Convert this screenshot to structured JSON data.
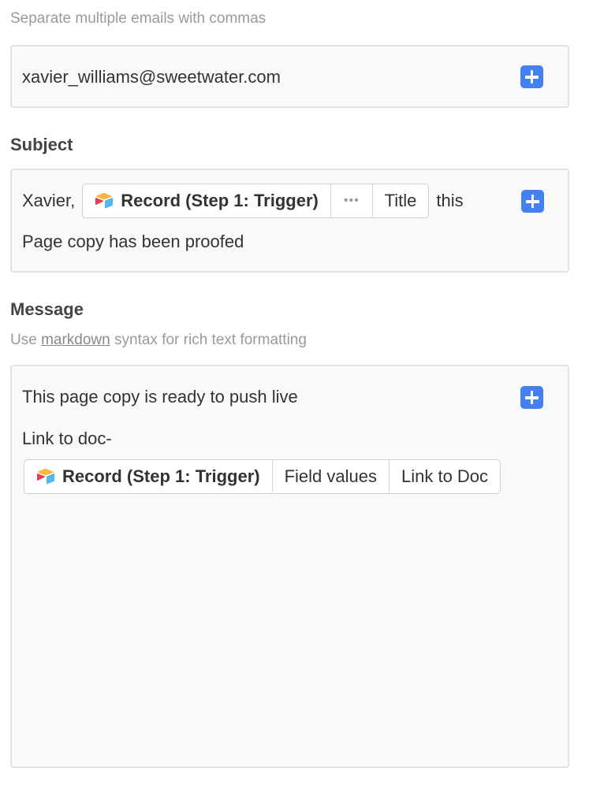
{
  "to": {
    "hint": "Separate multiple emails with commas",
    "value": "xavier_williams@sweetwater.com"
  },
  "subject": {
    "label": "Subject",
    "prefix": "Xavier,",
    "token": {
      "source": "Record (Step 1: Trigger)",
      "middle": "•••",
      "field": "Title"
    },
    "suffix": "this",
    "line2": "Page copy has been proofed"
  },
  "message": {
    "label": "Message",
    "hint_before": "Use",
    "hint_link": "markdown",
    "hint_after": "syntax for rich text formatting",
    "line1": "This page copy is ready to push live",
    "line2": "Link to doc-",
    "token": {
      "source": "Record (Step 1: Trigger)",
      "middle": "Field values",
      "field": "Link to Doc"
    }
  },
  "icons": {
    "insert": "plus-icon",
    "record": "airtable-record-icon"
  },
  "colors": {
    "accent": "#4380f0",
    "field_bg": "#f9f9f9",
    "field_border": "#e2e2e2"
  }
}
